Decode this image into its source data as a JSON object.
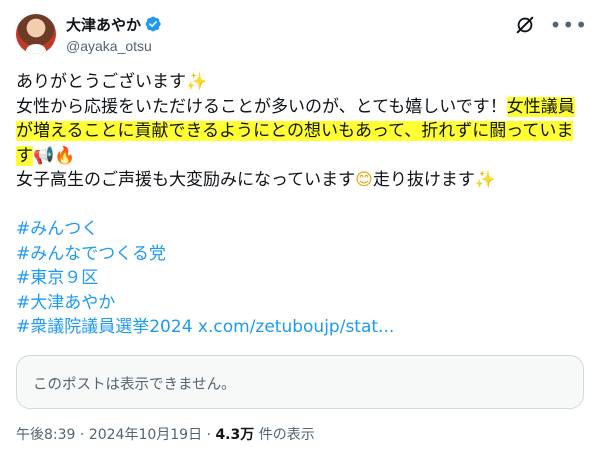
{
  "author": {
    "display_name": "大津あやか",
    "handle": "@ayaka_otsu"
  },
  "post": {
    "line1": "ありがとうございます",
    "line2_plain": "女性から応援をいただけることが多いのが、とても嬉しいです！",
    "line2_hl": "女性議員",
    "line3_hl": "が増えることに貢献できるようにとの想いもあって、折れずに闘っていま",
    "line4_hl": "す",
    "line5_a": "女子高生のご声援も大変励みになっています",
    "line5_b": "走り抜けます",
    "hashtags": [
      "#みんつく",
      "#みんなでつくる党",
      "#東京９区",
      "#大津あやか",
      "#衆議院議員選挙2024"
    ],
    "link": "x.com/zetuboujp/stat..."
  },
  "emoji": {
    "sparkle": "✨",
    "megaphone": "📢",
    "fire": "🔥",
    "smile": "😊"
  },
  "quote_card": {
    "text": "このポストは表示できません。"
  },
  "meta": {
    "time": "午後8:39",
    "sep": " · ",
    "date": "2024年10月19日",
    "sep2": " · ",
    "views_count": "4.3万",
    "views_label": " 件の表示"
  },
  "colors": {
    "highlight": "#ffff33",
    "link": "#1d9bf0",
    "verified": "#1d9bf0"
  },
  "icons": [
    "verified-badge-icon",
    "grok-icon",
    "more-options-icon"
  ]
}
